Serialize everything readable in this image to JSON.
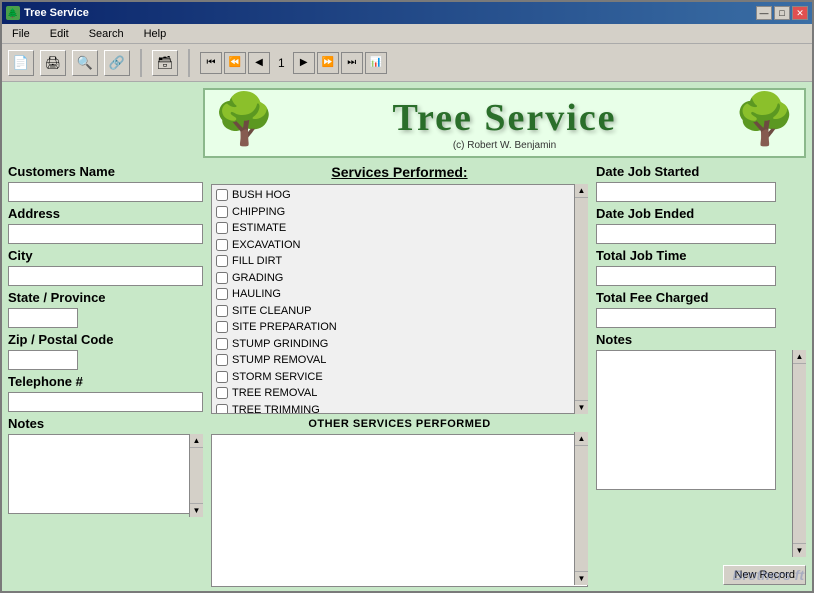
{
  "window": {
    "title": "Tree Service",
    "icon": "🌲"
  },
  "titlebar": {
    "minimize_label": "—",
    "maximize_label": "□",
    "close_label": "✕"
  },
  "menu": {
    "items": [
      "File",
      "Edit",
      "Search",
      "Help"
    ]
  },
  "toolbar": {
    "tools": [
      "📄",
      "🖨",
      "🔍",
      "🔗"
    ],
    "db_icon": "🗃",
    "page_num": "1"
  },
  "banner": {
    "title": "Tree Service",
    "subtitle": "(c) Robert W. Benjamin",
    "tree_left": "🌳",
    "tree_right": "🌳"
  },
  "left_form": {
    "customers_name_label": "Customers Name",
    "address_label": "Address",
    "city_label": "City",
    "state_label": "State / Province",
    "zip_label": "Zip / Postal Code",
    "phone_label": "Telephone #",
    "notes_label": "Notes"
  },
  "services": {
    "title": "Services Performed:",
    "items": [
      "BUSH HOG",
      "CHIPPING",
      "ESTIMATE",
      "EXCAVATION",
      "FILL DIRT",
      "GRADING",
      "HAULING",
      "SITE CLEANUP",
      "SITE PREPARATION",
      "STUMP GRINDING",
      "STUMP REMOVAL",
      "STORM SERVICE",
      "TREE REMOVAL",
      "TREE TRIMMING"
    ],
    "other_label": "OTHER SERVICES PERFORMED"
  },
  "right_form": {
    "date_started_label": "Date Job Started",
    "date_ended_label": "Date Job Ended",
    "total_time_label": "Total Job Time",
    "total_fee_label": "Total Fee Charged",
    "notes_label": "Notes"
  },
  "buttons": {
    "new_record": "New Record"
  },
  "watermark": "Brothers ft"
}
